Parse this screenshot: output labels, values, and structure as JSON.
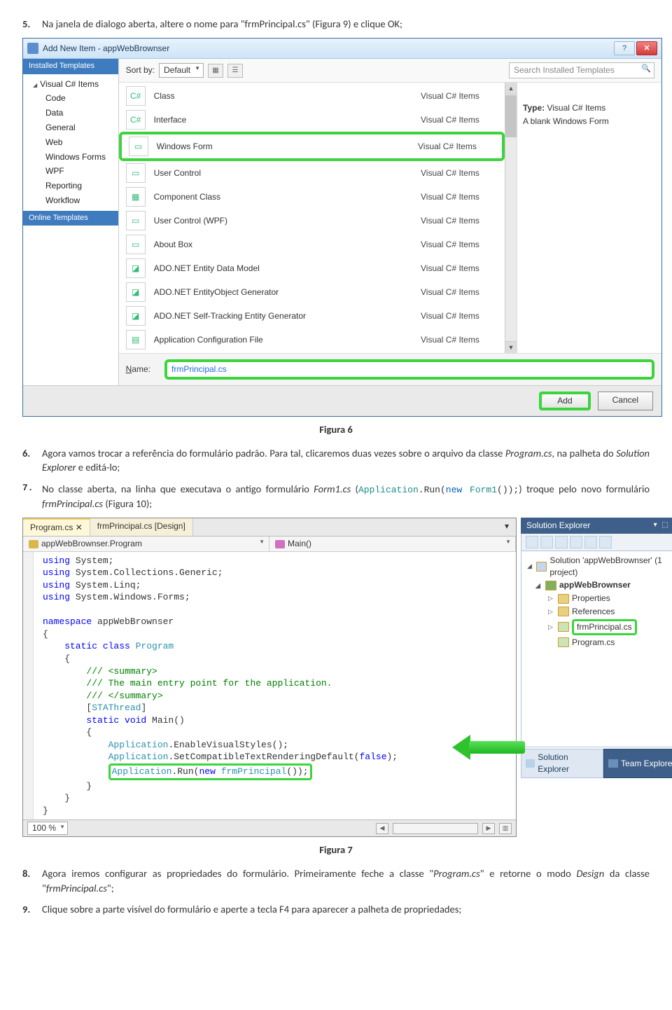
{
  "step5": {
    "num": "5.",
    "text_a": "Na janela de dialogo aberta, altere o nome para \"frmPrincipal.cs\" (Figura 9) e clique OK;"
  },
  "dialog": {
    "title": "Add New Item - appWebBrownser",
    "help": "?",
    "close": "✕",
    "left": {
      "installed": "Installed Templates",
      "root": "Visual C# Items",
      "items": [
        "Code",
        "Data",
        "General",
        "Web",
        "Windows Forms",
        "WPF",
        "Reporting",
        "Workflow"
      ],
      "online": "Online Templates"
    },
    "sort_label": "Sort by:",
    "sort_value": "Default",
    "search_placeholder": "Search Installed Templates",
    "rows": [
      {
        "icon": "C#",
        "name": "Class",
        "lang": "Visual C# Items"
      },
      {
        "icon": "C#",
        "name": "Interface",
        "lang": "Visual C# Items"
      },
      {
        "icon": "▭",
        "name": "Windows Form",
        "lang": "Visual C# Items",
        "hl": true
      },
      {
        "icon": "▭",
        "name": "User Control",
        "lang": "Visual C# Items"
      },
      {
        "icon": "▦",
        "name": "Component Class",
        "lang": "Visual C# Items"
      },
      {
        "icon": "▭",
        "name": "User Control (WPF)",
        "lang": "Visual C# Items"
      },
      {
        "icon": "▭",
        "name": "About Box",
        "lang": "Visual C# Items"
      },
      {
        "icon": "◪",
        "name": "ADO.NET Entity Data Model",
        "lang": "Visual C# Items"
      },
      {
        "icon": "◪",
        "name": "ADO.NET EntityObject Generator",
        "lang": "Visual C# Items"
      },
      {
        "icon": "◪",
        "name": "ADO.NET Self-Tracking Entity Generator",
        "lang": "Visual C# Items"
      },
      {
        "icon": "▤",
        "name": "Application Configuration File",
        "lang": "Visual C# Items"
      }
    ],
    "right": {
      "type_label": "Type:",
      "type_value": "Visual C# Items",
      "desc": "A blank Windows Form"
    },
    "name_label": "Name:",
    "name_value": "frmPrincipal.cs",
    "add": "Add",
    "cancel": "Cancel"
  },
  "fig6": "Figura 6",
  "step6": {
    "num": "6.",
    "text": "Agora vamos trocar a referência do formulário padrão. Para tal, clicaremos duas vezes sobre o arquivo da classe Program.cs, na palheta do Solution Explorer e editá-lo;"
  },
  "step7": {
    "num": "7.",
    "pre": "No classe aberta, na linha que executava o antigo formulário ",
    "form1": "Form1.cs",
    "open": " (",
    "code_a": "Application",
    "code_b": ".Run(",
    "code_c": "new",
    "code_d": " Form1",
    "code_e": "());",
    "post": ") troque pelo novo formulário ",
    "frm": "frmPrincipal.cs",
    "fig": " (Figura 10);"
  },
  "vs": {
    "tab1": "Program.cs",
    "tab1x": "✕",
    "tab2": "frmPrincipal.cs [Design]",
    "nav1": "appWebBrownser.Program",
    "nav2": "Main()",
    "zoom": "100 %",
    "se_title": "Solution Explorer",
    "se_winbtns": "▾ ⬚ ✕",
    "tree": {
      "sln": "Solution 'appWebBrownser' (1 project)",
      "proj": "appWebBrownser",
      "props": "Properties",
      "refs": "References",
      "frm": "frmPrincipal.cs",
      "prog": "Program.cs"
    },
    "btm1": "Solution Explorer",
    "btm2": "Team Explorer"
  },
  "code_lines": {
    "l1a": "using",
    "l1b": " System;",
    "l2a": "using",
    "l2b": " System.Collections.Generic;",
    "l3a": "using",
    "l3b": " System.Linq;",
    "l4a": "using",
    "l4b": " System.Windows.Forms;",
    "l5a": "namespace",
    "l5b": " appWebBrownser",
    "l6": "{",
    "l7a": "    static class ",
    "l7b": "Program",
    "l8": "    {",
    "l9": "        /// <summary>",
    "l10": "        /// The main entry point for the application.",
    "l11": "        /// </summary>",
    "l12a": "        [",
    "l12b": "STAThread",
    "l12c": "]",
    "l13a": "        static void ",
    "l13b": "Main",
    "l13c": "()",
    "l14": "        {",
    "l15a": "            Application",
    "l15b": ".EnableVisualStyles();",
    "l16a": "            Application",
    "l16b": ".SetCompatibleTextRenderingDefault(",
    "l16c": "false",
    "l16d": ");",
    "l17a": "Application",
    "l17b": ".Run(",
    "l17c": "new ",
    "l17d": "frmPrincipal",
    "l17e": "());",
    "l18": "        }",
    "l19": "    }",
    "l20": "}"
  },
  "fig7": "Figura 7",
  "step8": {
    "num": "8.",
    "text": "Agora iremos configurar as propriedades do formulário. Primeiramente feche a classe \"Program.cs\" e retorne o modo Design da classe \"frmPrincipal.cs\";"
  },
  "step9": {
    "num": "9.",
    "text": "Clique sobre a parte visível do formulário e aperte a tecla F4 para aparecer a palheta de propriedades;"
  }
}
